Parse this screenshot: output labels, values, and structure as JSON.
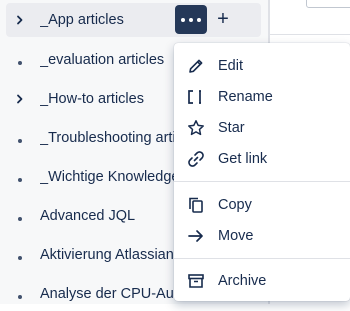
{
  "tree": {
    "items": [
      {
        "label": "_App articles",
        "lead": "chevron"
      },
      {
        "label": "_evaluation articles",
        "lead": "dot"
      },
      {
        "label": "_How-to articles",
        "lead": "chevron"
      },
      {
        "label": "_Troubleshooting arti",
        "lead": "dot"
      },
      {
        "label": "_Wichtige Knowledgeb",
        "lead": "dot"
      },
      {
        "label": "Advanced JQL",
        "lead": "dot"
      },
      {
        "label": "Aktivierung Atlassian",
        "lead": "dot"
      },
      {
        "label": "Analyse der CPU-Aus",
        "lead": "dot"
      }
    ],
    "add_symbol": "+"
  },
  "menu": {
    "items": [
      {
        "label": "Edit",
        "icon": "pencil-icon"
      },
      {
        "label": "Rename",
        "icon": "rename-cursor-icon"
      },
      {
        "label": "Star",
        "icon": "star-icon"
      },
      {
        "label": "Get link",
        "icon": "link-icon"
      },
      {
        "label": "Copy",
        "icon": "copy-icon"
      },
      {
        "label": "Move",
        "icon": "arrow-right-icon"
      },
      {
        "label": "Archive",
        "icon": "archive-icon"
      }
    ]
  },
  "colors": {
    "text": "#172b4d",
    "more_button_bg": "#253858",
    "active_row_bg": "#ebecf0",
    "sidebar_bg": "#f7f8f9"
  }
}
